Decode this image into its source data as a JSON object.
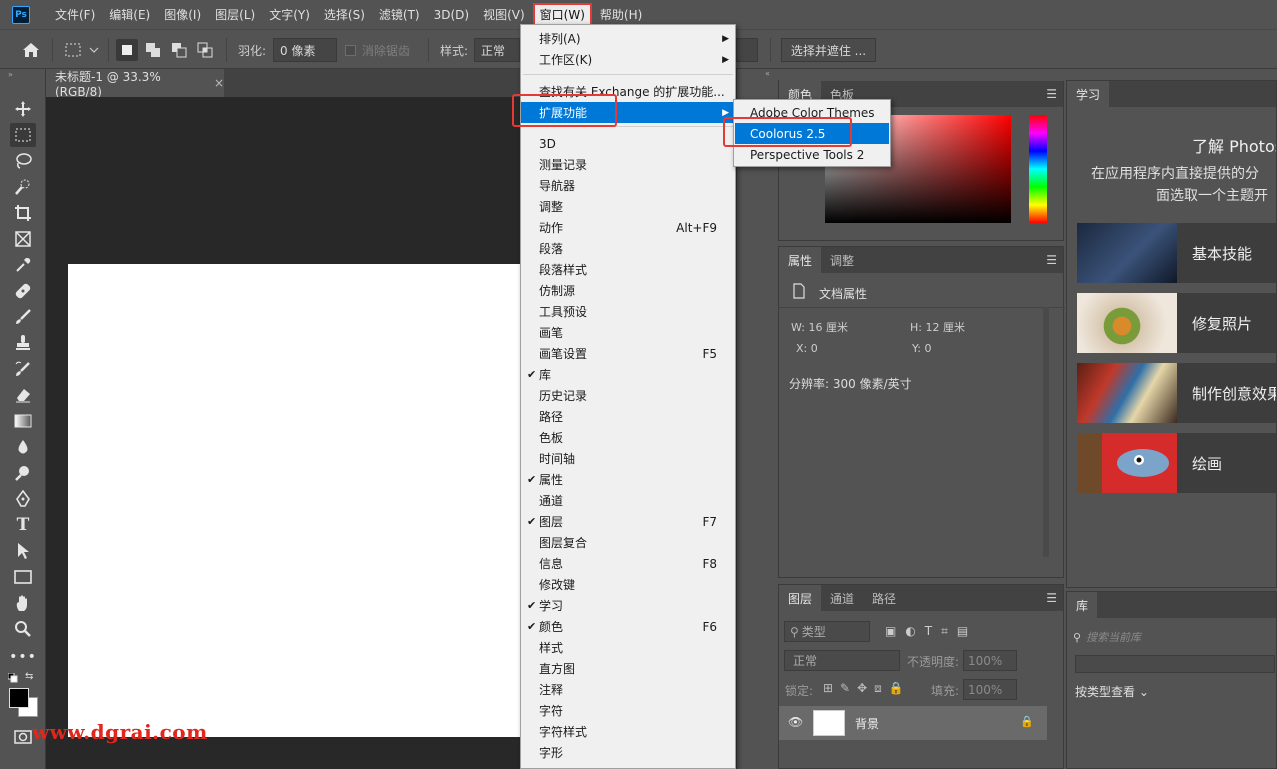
{
  "app": {
    "logo_text": "Ps"
  },
  "menubar": {
    "items": [
      "文件(F)",
      "编辑(E)",
      "图像(I)",
      "图层(L)",
      "文字(Y)",
      "选择(S)",
      "滤镜(T)",
      "3D(D)",
      "视图(V)",
      "窗口(W)",
      "帮助(H)"
    ],
    "active_index": 9
  },
  "options": {
    "feather_label": "羽化:",
    "feather_value": "0 像素",
    "antialias_label": "消除锯齿",
    "style_label": "样式:",
    "style_value": "正常",
    "select_mask_button": "选择并遮住 ..."
  },
  "document": {
    "tab_title": "未标题-1 @ 33.3%(RGB/8)",
    "close_glyph": "×"
  },
  "watermark": "www.dgrai.com",
  "window_menu": {
    "items": [
      {
        "label": "排列(A)",
        "submenu": true
      },
      {
        "label": "工作区(K)",
        "submenu": true
      },
      {
        "label": "查找有关 Exchange 的扩展功能..."
      },
      {
        "label": "扩展功能",
        "submenu": true,
        "highlighted": true
      },
      {
        "label": "3D"
      },
      {
        "label": "测量记录"
      },
      {
        "label": "导航器"
      },
      {
        "label": "调整"
      },
      {
        "label": "动作",
        "shortcut": "Alt+F9"
      },
      {
        "label": "段落"
      },
      {
        "label": "段落样式"
      },
      {
        "label": "仿制源"
      },
      {
        "label": "工具预设"
      },
      {
        "label": "画笔"
      },
      {
        "label": "画笔设置",
        "shortcut": "F5"
      },
      {
        "label": "库",
        "checked": true
      },
      {
        "label": "历史记录"
      },
      {
        "label": "路径"
      },
      {
        "label": "色板"
      },
      {
        "label": "时间轴"
      },
      {
        "label": "属性",
        "checked": true
      },
      {
        "label": "通道"
      },
      {
        "label": "图层",
        "checked": true,
        "shortcut": "F7"
      },
      {
        "label": "图层复合"
      },
      {
        "label": "信息",
        "shortcut": "F8"
      },
      {
        "label": "修改键"
      },
      {
        "label": "学习",
        "checked": true
      },
      {
        "label": "颜色",
        "checked": true,
        "shortcut": "F6"
      },
      {
        "label": "样式"
      },
      {
        "label": "直方图"
      },
      {
        "label": "注释"
      },
      {
        "label": "字符"
      },
      {
        "label": "字符样式"
      },
      {
        "label": "字形"
      }
    ]
  },
  "extensions_submenu": {
    "items": [
      {
        "label": "Adobe Color Themes"
      },
      {
        "label": "Coolorus 2.5",
        "highlighted": true
      },
      {
        "label": "Perspective Tools 2"
      }
    ]
  },
  "color_panel": {
    "tabs": [
      "颜色",
      "色板"
    ]
  },
  "properties_panel": {
    "tabs": [
      "属性",
      "调整"
    ],
    "doc_label": "文档属性",
    "w_label": "W:",
    "w_value": "16 厘米",
    "h_label": "H:",
    "h_value": "12 厘米",
    "x_label": "X:",
    "x_value": "0",
    "y_label": "Y:",
    "y_value": "0",
    "resolution": "分辨率: 300 像素/英寸"
  },
  "layers_panel": {
    "tabs": [
      "图层",
      "通道",
      "路径"
    ],
    "filter_kind": "类型",
    "blend_mode": "正常",
    "opacity_label": "不透明度:",
    "opacity_value": "100%",
    "lock_label": "锁定:",
    "fill_label": "填充:",
    "fill_value": "100%",
    "layer_name": "背景"
  },
  "learn_panel": {
    "tab": "学习",
    "title": "了解 Photos",
    "desc_line1": "在应用程序内直接提供的分",
    "desc_line2": "面选取一个主题开",
    "cards": [
      "基本技能",
      "修复照片",
      "制作创意效果",
      "绘画"
    ]
  },
  "library_panel": {
    "tab": "库",
    "search_placeholder": "搜索当前库",
    "view_by": "按类型查看"
  },
  "colors": {
    "accent": "#0078d7",
    "annotation_red": "#e53935"
  }
}
